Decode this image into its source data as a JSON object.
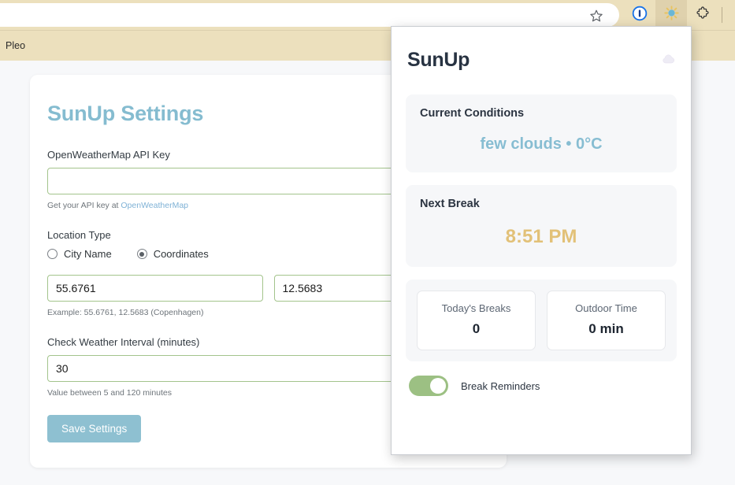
{
  "browser": {
    "tab_title": "Pleo",
    "toolbar": {
      "bookmark_icon": "star-icon",
      "password_manager_icon": "one-password-icon",
      "extension_icon": "sunup-sun-icon",
      "extensions_menu_icon": "puzzle-piece-icon"
    }
  },
  "settings_page": {
    "title": "SunUp Settings",
    "api_key": {
      "label": "OpenWeatherMap API Key",
      "value": "",
      "placeholder": "",
      "hint_prefix": "Get your API key at ",
      "hint_link": "OpenWeatherMap"
    },
    "location_type": {
      "label": "Location Type",
      "options": [
        {
          "label": "City Name",
          "selected": false
        },
        {
          "label": "Coordinates",
          "selected": true
        }
      ]
    },
    "coordinates": {
      "latitude": "55.6761",
      "longitude": "12.5683",
      "hint": "Example: 55.6761, 12.5683 (Copenhagen)"
    },
    "interval": {
      "label": "Check Weather Interval (minutes)",
      "value": "30",
      "hint": "Value between 5 and 120 minutes"
    },
    "save_button": "Save Settings",
    "accent_color": "#8ec0d1",
    "input_border_color": "#a3c48c"
  },
  "popup": {
    "title": "SunUp",
    "weather_icon": "☁",
    "current_conditions": {
      "title": "Current Conditions",
      "value": "few clouds • 0°C",
      "color": "#87bdd2"
    },
    "next_break": {
      "title": "Next Break",
      "value": "8:51 PM",
      "color": "#e2c178"
    },
    "stats": [
      {
        "label": "Today's Breaks",
        "value": "0"
      },
      {
        "label": "Outdoor Time",
        "value": "0 min"
      }
    ],
    "toggle": {
      "label": "Break Reminders",
      "on": true,
      "on_color": "#9cc083"
    }
  }
}
